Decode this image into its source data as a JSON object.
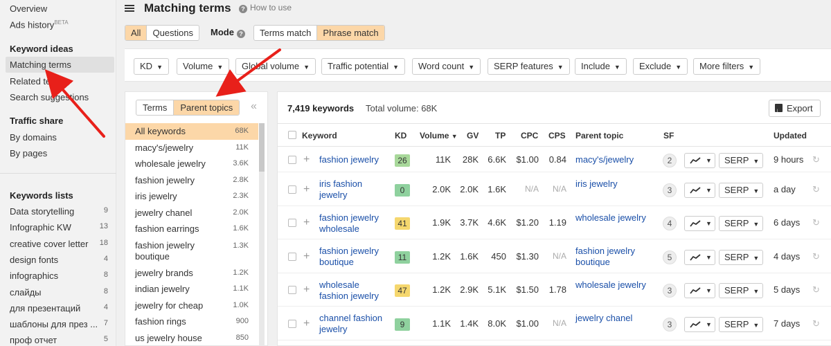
{
  "sidebar": {
    "top_items": [
      {
        "label": "Overview"
      },
      {
        "label": "Ads history",
        "badge": "BETA"
      }
    ],
    "keyword_ideas": {
      "heading": "Keyword ideas",
      "items": [
        {
          "label": "Matching terms",
          "active": true
        },
        {
          "label": "Related terms"
        },
        {
          "label": "Search suggestions"
        }
      ]
    },
    "traffic_share": {
      "heading": "Traffic share",
      "items": [
        {
          "label": "By domains"
        },
        {
          "label": "By pages"
        }
      ]
    },
    "keyword_lists": {
      "heading": "Keywords lists",
      "items": [
        {
          "label": "Data storytelling",
          "count": "9"
        },
        {
          "label": "Infographic KW",
          "count": "13"
        },
        {
          "label": "creative cover letter",
          "count": "18"
        },
        {
          "label": "design fonts",
          "count": "4"
        },
        {
          "label": "infographics",
          "count": "8"
        },
        {
          "label": "слайды",
          "count": "8"
        },
        {
          "label": "для презентаций",
          "count": "4"
        },
        {
          "label": "шаблоны для през ...",
          "count": "7"
        },
        {
          "label": "проф отчет",
          "count": "5"
        }
      ]
    }
  },
  "header": {
    "title": "Matching terms",
    "help": "How to use",
    "scope_tabs": [
      {
        "label": "All",
        "active": true
      },
      {
        "label": "Questions"
      }
    ],
    "mode_label": "Mode",
    "mode_tabs": [
      {
        "label": "Terms match"
      },
      {
        "label": "Phrase match",
        "active": true
      }
    ]
  },
  "filters": [
    "KD",
    "Volume",
    "Global volume",
    "Traffic potential",
    "Word count",
    "SERP features",
    "Include",
    "Exclude",
    "More filters"
  ],
  "left_panel": {
    "tabs": [
      {
        "label": "Terms"
      },
      {
        "label": "Parent topics",
        "active": true
      }
    ],
    "collapse_glyph": "«",
    "items": [
      {
        "label": "All keywords",
        "count": "68K",
        "active": true
      },
      {
        "label": "macy's/jewelry",
        "count": "11K"
      },
      {
        "label": "wholesale jewelry",
        "count": "3.6K"
      },
      {
        "label": "fashion jewelry",
        "count": "2.8K"
      },
      {
        "label": "iris jewelry",
        "count": "2.3K"
      },
      {
        "label": "jewelry chanel",
        "count": "2.0K"
      },
      {
        "label": "fashion earrings",
        "count": "1.6K"
      },
      {
        "label": "fashion jewelry boutique",
        "count": "1.3K"
      },
      {
        "label": "jewelry brands",
        "count": "1.2K"
      },
      {
        "label": "indian jewelry",
        "count": "1.1K"
      },
      {
        "label": "jewelry for cheap",
        "count": "1.0K"
      },
      {
        "label": "fashion rings",
        "count": "900"
      },
      {
        "label": "us jewelry house",
        "count": "850"
      }
    ]
  },
  "main": {
    "count_label": "7,419 keywords",
    "total_volume": "Total volume: 68K",
    "export_label": "Export",
    "columns": [
      "Keyword",
      "KD",
      "Volume",
      "GV",
      "TP",
      "CPC",
      "CPS",
      "Parent topic",
      "SF",
      "Updated"
    ],
    "sort_glyph": "▼",
    "serp_label": "SERP",
    "refresh_glyph": "↻",
    "colors": {
      "kd_green": "#8fd19e",
      "kd_yellow": "#f5d76e",
      "link": "#1a4fa8"
    },
    "rows": [
      {
        "keyword": "fashion jewelry",
        "kd": "26",
        "kd_color": "#a8d89a",
        "volume": "11K",
        "gv": "28K",
        "tp": "6.6K",
        "cpc": "$1.00",
        "cps": "0.84",
        "parent": "macy's/jewelry",
        "sf": "2",
        "updated": "9 hours"
      },
      {
        "keyword": "iris fashion jewelry",
        "kd": "0",
        "kd_color": "#8fd19e",
        "volume": "2.0K",
        "gv": "2.0K",
        "tp": "1.6K",
        "cpc": "N/A",
        "cps": "N/A",
        "parent": "iris jewelry",
        "sf": "3",
        "updated": "a day"
      },
      {
        "keyword": "fashion jewelry wholesale",
        "kd": "41",
        "kd_color": "#f5d76e",
        "volume": "1.9K",
        "gv": "3.7K",
        "tp": "4.6K",
        "cpc": "$1.20",
        "cps": "1.19",
        "parent": "wholesale jewelry",
        "sf": "4",
        "updated": "6 days"
      },
      {
        "keyword": "fashion jewelry boutique",
        "kd": "11",
        "kd_color": "#8fd19e",
        "volume": "1.2K",
        "gv": "1.6K",
        "tp": "450",
        "cpc": "$1.30",
        "cps": "N/A",
        "parent": "fashion jewelry boutique",
        "sf": "5",
        "updated": "4 days"
      },
      {
        "keyword": "wholesale fashion jewelry",
        "kd": "47",
        "kd_color": "#f5d76e",
        "volume": "1.2K",
        "gv": "2.9K",
        "tp": "5.1K",
        "cpc": "$1.50",
        "cps": "1.78",
        "parent": "wholesale jewelry",
        "sf": "3",
        "updated": "5 days"
      },
      {
        "keyword": "channel fashion jewelry",
        "kd": "9",
        "kd_color": "#8fd19e",
        "volume": "1.1K",
        "gv": "1.4K",
        "tp": "8.0K",
        "cpc": "$1.00",
        "cps": "N/A",
        "parent": "jewelry chanel",
        "sf": "3",
        "updated": "7 days"
      }
    ]
  }
}
